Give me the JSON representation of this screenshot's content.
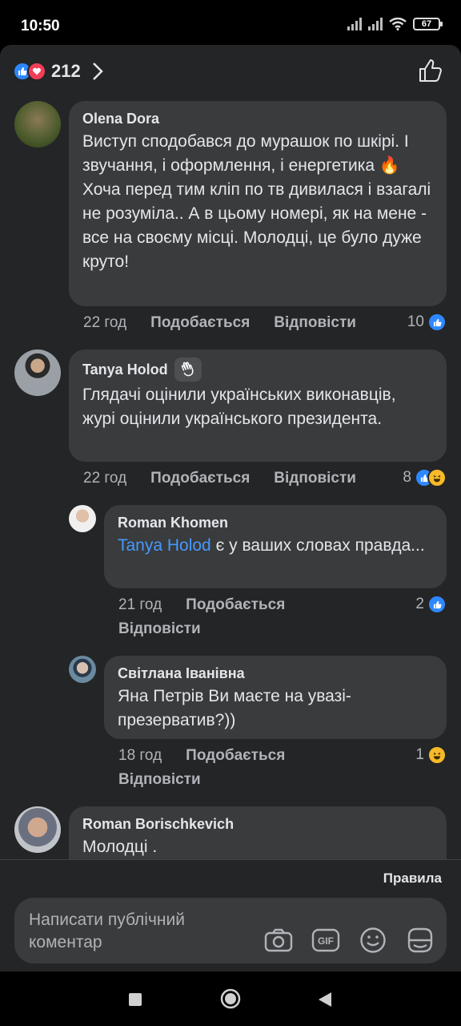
{
  "status": {
    "time": "10:50",
    "battery": "67"
  },
  "header": {
    "reaction_count": "212"
  },
  "comments": [
    {
      "author": "Olena Dora",
      "text": "Виступ сподобався до мурашок по шкірі. І звучання, і оформлення, і енергетика 🔥\nХоча перед тим кліп по тв дивилася і взагалі не розуміла.. А в цьому номері, як на мене - все на своєму місці. Молодці, це було дуже круто!",
      "time": "22 год",
      "like_label": "Подобається",
      "reply_label": "Відповісти",
      "reactions": "10"
    },
    {
      "author": "Tanya Holod",
      "text": "Глядачі оцінили українських виконавців, журі оцінили українського президента.",
      "time": "22 год",
      "like_label": "Подобається",
      "reply_label": "Відповісти",
      "reactions": "8"
    },
    {
      "author": "Roman Khomen",
      "mention": "Tanya Holod",
      "text": "є у ваших словах правда...",
      "time": "21 год",
      "like_label": "Подобається",
      "reply_label": "Відповісти",
      "reactions": "2"
    },
    {
      "author": "Світлана Іванівна",
      "text": "Яна Петрів Ви маєте на увазі-презерватив?))",
      "time": "18 год",
      "like_label": "Подобається",
      "reply_label": "Відповісти",
      "reactions": "1"
    },
    {
      "author": "Roman Borischkevich",
      "text": "Молодці ."
    }
  ],
  "footer": {
    "rules_label": "Правила",
    "composer_placeholder": "Написати публічний коментар"
  },
  "colors": {
    "like": "#2d88ff",
    "love": "#f33e58",
    "mention": "#4599ff",
    "bubble": "#3a3b3c",
    "sheet": "#242526"
  },
  "icons": [
    "like-reaction-icon",
    "love-reaction-icon",
    "chevron-right-icon",
    "thumbs-up-icon",
    "wave-icon",
    "haha-reaction-icon",
    "camera-icon",
    "gif-icon",
    "emoji-icon",
    "sticker-icon",
    "square-nav-icon",
    "circle-nav-icon",
    "back-nav-icon"
  ]
}
